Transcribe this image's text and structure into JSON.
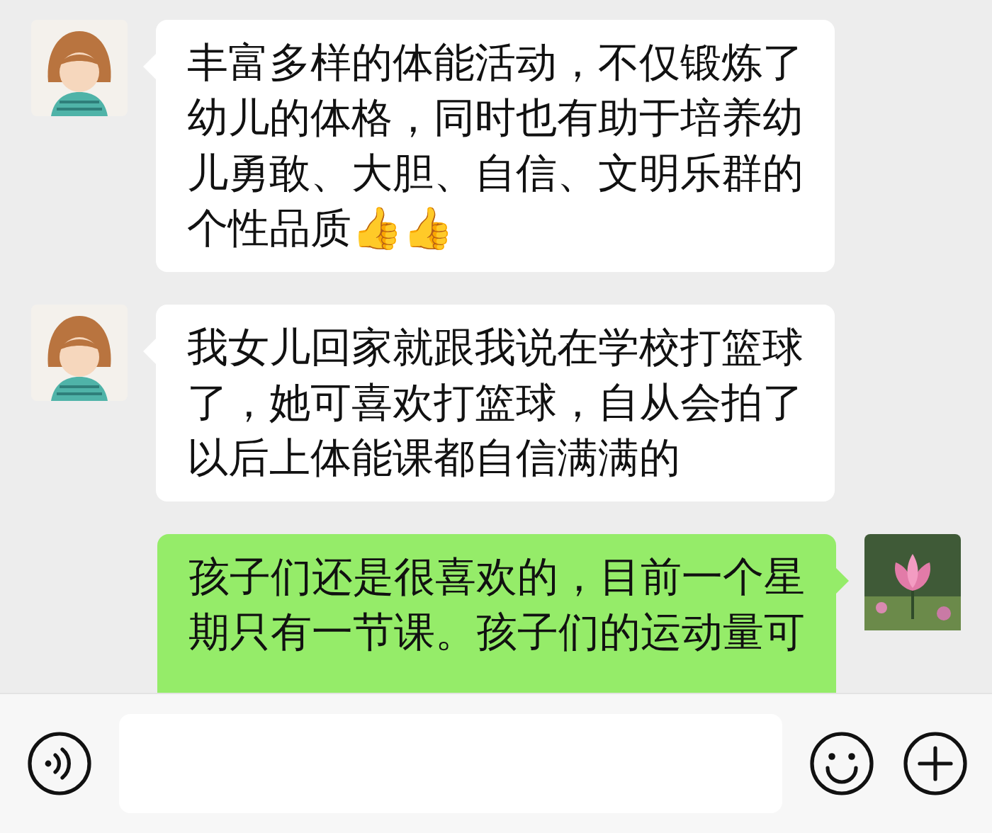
{
  "messages": [
    {
      "outgoing": false,
      "avatar": {
        "kind": "cartoon"
      },
      "text": "丰富多样的体能活动，不仅锻炼了幼儿的体格，同时也有助于培养幼儿勇敢、大胆、自信、文明乐群的个性品质👍👍"
    },
    {
      "outgoing": false,
      "avatar": {
        "kind": "cartoon"
      },
      "text": "我女儿回家就跟我说在学校打篮球了，她可喜欢打篮球，自从会拍了以后上体能课都自信满满的"
    },
    {
      "outgoing": true,
      "text": "孩子们还是很喜欢的，目前一个星期只有一节课。孩子们的运动量可"
    }
  ]
}
